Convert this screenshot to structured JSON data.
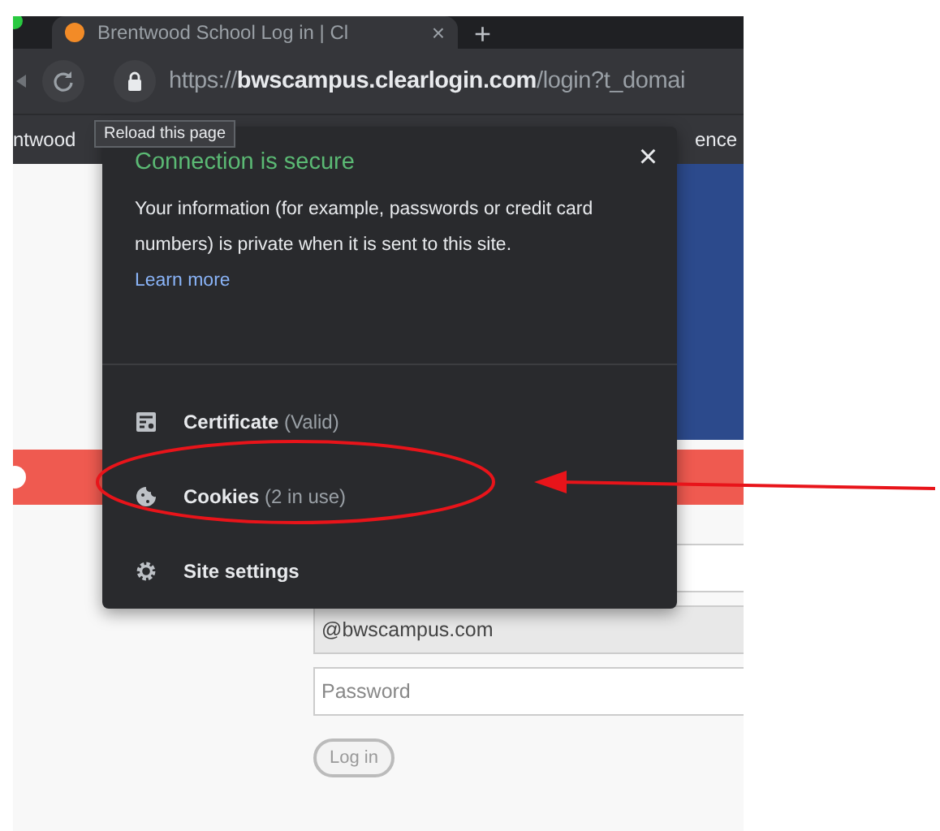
{
  "tab": {
    "title": "Brentwood School Log in | Cl",
    "close": "×"
  },
  "new_tab": "+",
  "address": {
    "scheme": "https://",
    "host": "bwscampus.clearlogin.com",
    "path": "/login?t_domai"
  },
  "tooltip": "Reload this page",
  "bookmarks": [
    "ntwood",
    "ence"
  ],
  "popup": {
    "title": "Connection is secure",
    "close": "×",
    "description": "Your information (for example, passwords or credit card numbers) is private when it is sent to this site.",
    "link": "Learn more",
    "items": [
      {
        "kind": "certificate",
        "label": "Certificate",
        "detail": "(Valid)"
      },
      {
        "kind": "cookies",
        "label": "Cookies",
        "detail": "(2 in use)"
      },
      {
        "kind": "settings",
        "label": "Site settings"
      }
    ]
  },
  "login": {
    "email_value": "@bwscampus.com",
    "password_placeholder": "Password",
    "button": "Log in"
  }
}
